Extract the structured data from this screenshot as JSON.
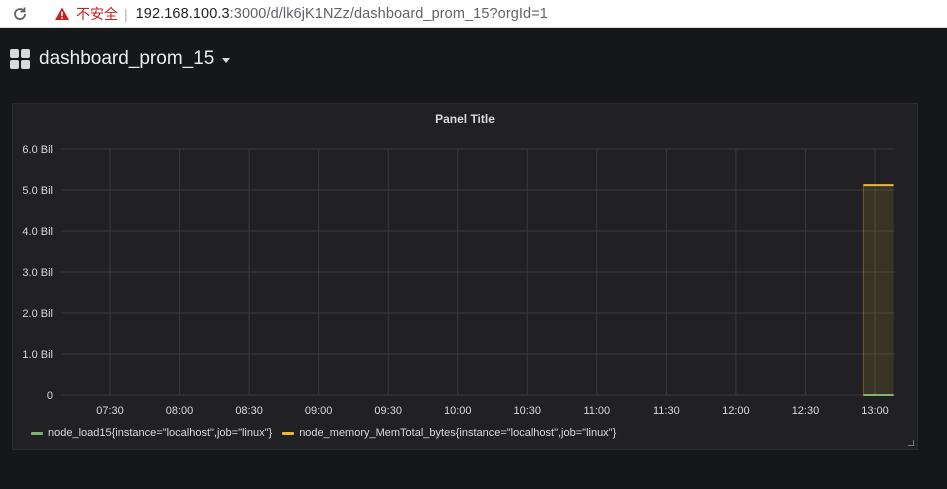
{
  "browser": {
    "security_label": "不安全",
    "separator": "|",
    "url_host": "192.168.100.3",
    "url_rest": ":3000/d/lk6jK1NZz/dashboard_prom_15?orgId=1"
  },
  "dashboard": {
    "title": "dashboard_prom_15"
  },
  "panel": {
    "title": "Panel Title"
  },
  "colors": {
    "series1": "#7eb26d",
    "series2": "#eab839",
    "grid": "#3a3a3e",
    "axis_text": "#d8d9da"
  },
  "chart_data": {
    "type": "line",
    "title": "Panel Title",
    "x": [
      "07:30",
      "08:00",
      "08:30",
      "09:00",
      "09:30",
      "10:00",
      "10:30",
      "11:00",
      "11:30",
      "12:00",
      "12:30",
      "13:00"
    ],
    "y_ticks": [
      "0",
      "1.0 Bil",
      "2.0 Bil",
      "3.0 Bil",
      "4.0 Bil",
      "5.0 Bil",
      "6.0 Bil"
    ],
    "ylim": [
      0,
      6000000000
    ],
    "grid": true,
    "legend_position": "bottom-left",
    "series": [
      {
        "name": "node_load15{instance=\"localhost\",job=\"linux\"}",
        "color": "#7eb26d",
        "x_range": [
          "12:55",
          "13:08"
        ],
        "value": 0
      },
      {
        "name": "node_memory_MemTotal_bytes{instance=\"localhost\",job=\"linux\"}",
        "color": "#eab839",
        "x_range": [
          "12:55",
          "13:08"
        ],
        "value": 5120000000
      }
    ]
  }
}
